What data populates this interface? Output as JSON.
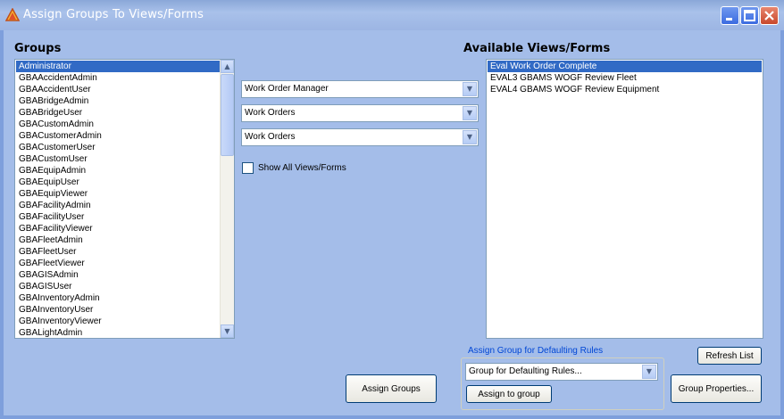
{
  "window": {
    "title": "Assign Groups To Views/Forms"
  },
  "groups": {
    "heading": "Groups",
    "items": [
      "Administrator",
      "GBAAccidentAdmin",
      "GBAAccidentUser",
      "GBABridgeAdmin",
      "GBABridgeUser",
      "GBACustomAdmin",
      "GBACustomerAdmin",
      "GBACustomerUser",
      "GBACustomUser",
      "GBAEquipAdmin",
      "GBAEquipUser",
      "GBAEquipViewer",
      "GBAFacilityAdmin",
      "GBAFacilityUser",
      "GBAFacilityViewer",
      "GBAFleetAdmin",
      "GBAFleetUser",
      "GBAFleetViewer",
      "GBAGISAdmin",
      "GBAGISUser",
      "GBAInventoryAdmin",
      "GBAInventoryUser",
      "GBAInventoryViewer",
      "GBALightAdmin"
    ],
    "selected_index": 0
  },
  "filters": {
    "combo1": "Work Order Manager",
    "combo2": "Work Orders",
    "combo3": "Work Orders",
    "show_all_label": "Show All Views/Forms",
    "show_all_checked": false
  },
  "views": {
    "heading": "Available Views/Forms",
    "items": [
      "Eval Work Order Complete",
      "EVAL3 GBAMS WOGF Review Fleet",
      "EVAL4 GBAMS WOGF Review Equipment"
    ],
    "selected_index": 0
  },
  "defaulting": {
    "group_label": "Assign Group for Defaulting Rules",
    "combo_value": "Group for Defaulting Rules...",
    "assign_button": "Assign to group"
  },
  "buttons": {
    "assign_groups": "Assign Groups",
    "refresh_list": "Refresh List",
    "group_properties": "Group Properties..."
  },
  "colors": {
    "selection": "#316ac5",
    "client_bg": "#a4bde9",
    "groupbox_label": "#0046d5"
  }
}
